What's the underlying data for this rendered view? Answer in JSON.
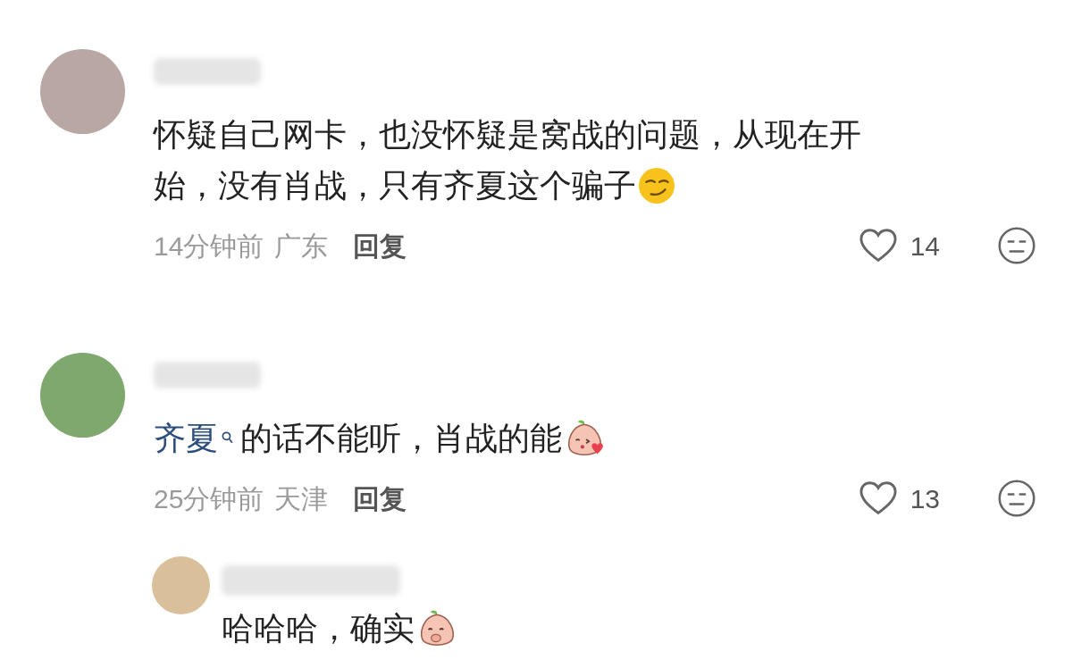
{
  "comments": [
    {
      "lines": [
        [
          {
            "kind": "text",
            "text": "怀疑自己网卡，也没怀疑是窝战的问题，从现在开"
          }
        ],
        [
          {
            "kind": "text",
            "text": "始，没有肖战，只有齐夏这个骗子"
          },
          {
            "kind": "smirk-emoji"
          }
        ]
      ],
      "time": "14分钟前",
      "location": "广东",
      "reply_label": "回复",
      "likes": "14",
      "liked": false
    },
    {
      "lines": [
        [
          {
            "kind": "mention",
            "text": "齐夏"
          },
          {
            "kind": "text",
            "text": "的话不能听，肖战的能"
          },
          {
            "kind": "kiss-sticker"
          }
        ]
      ],
      "time": "25分钟前",
      "location": "天津",
      "reply_label": "回复",
      "likes": "13",
      "liked": false,
      "replies": [
        {
          "lines": [
            [
              {
                "kind": "text",
                "text": "哈哈哈，确实"
              },
              {
                "kind": "shy-sticker"
              }
            ]
          ]
        }
      ]
    }
  ]
}
